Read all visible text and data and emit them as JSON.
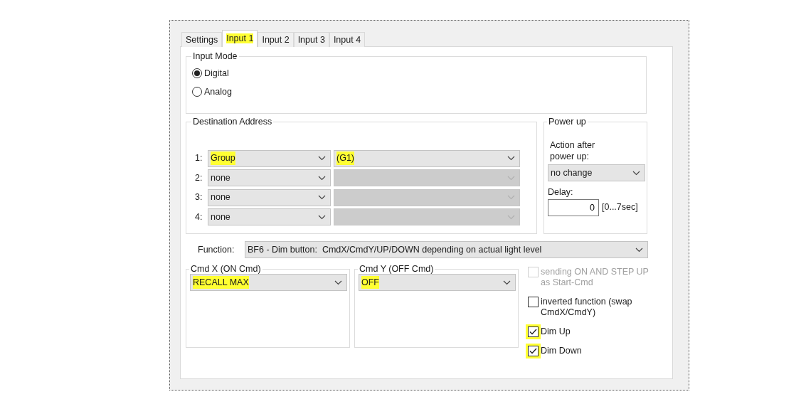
{
  "tabs": [
    {
      "label": "Settings",
      "selected": false,
      "highlighted": false
    },
    {
      "label": "Input 1",
      "selected": true,
      "highlighted": true
    },
    {
      "label": "Input 2",
      "selected": false,
      "highlighted": false
    },
    {
      "label": "Input 3",
      "selected": false,
      "highlighted": false
    },
    {
      "label": "Input 4",
      "selected": false,
      "highlighted": false
    }
  ],
  "input_mode": {
    "title": "Input Mode",
    "options": [
      {
        "label": "Digital",
        "selected": true
      },
      {
        "label": "Analog",
        "selected": false
      }
    ]
  },
  "destination_address": {
    "title": "Destination Address",
    "rows": [
      {
        "index": "1:",
        "type": {
          "value": "Group",
          "highlighted": true
        },
        "address": {
          "value": "(G1)",
          "highlighted": true,
          "disabled": false
        }
      },
      {
        "index": "2:",
        "type": {
          "value": "none",
          "highlighted": false
        },
        "address": {
          "disabled": true
        }
      },
      {
        "index": "3:",
        "type": {
          "value": "none",
          "highlighted": false
        },
        "address": {
          "disabled": true
        }
      },
      {
        "index": "4:",
        "type": {
          "value": "none",
          "highlighted": false
        },
        "address": {
          "disabled": true
        }
      }
    ]
  },
  "power_up": {
    "title": "Power up",
    "action_label": "Action after power up:",
    "action": {
      "value": "no change"
    },
    "delay_label": "Delay:",
    "delay": {
      "value": "0"
    },
    "delay_range": "[0...7sec]"
  },
  "function": {
    "label": "Function:",
    "value": "BF6 - Dim button:  CmdX/CmdY/UP/DOWN depending on actual light level"
  },
  "cmd_x": {
    "title": "Cmd X  (ON Cmd)",
    "value": "RECALL MAX",
    "highlighted": true
  },
  "cmd_y": {
    "title": "Cmd Y  (OFF Cmd)",
    "value": "OFF",
    "highlighted": true
  },
  "options": [
    {
      "label": "sending ON AND STEP UP as Start-Cmd",
      "checked": false,
      "disabled": true,
      "highlighted": false
    },
    {
      "label": "inverted function (swap CmdX/CmdY)",
      "checked": false,
      "disabled": false,
      "highlighted": false
    },
    {
      "label": "Dim Up",
      "checked": true,
      "disabled": false,
      "highlighted": true
    },
    {
      "label": "Dim Down",
      "checked": true,
      "disabled": false,
      "highlighted": true
    }
  ]
}
